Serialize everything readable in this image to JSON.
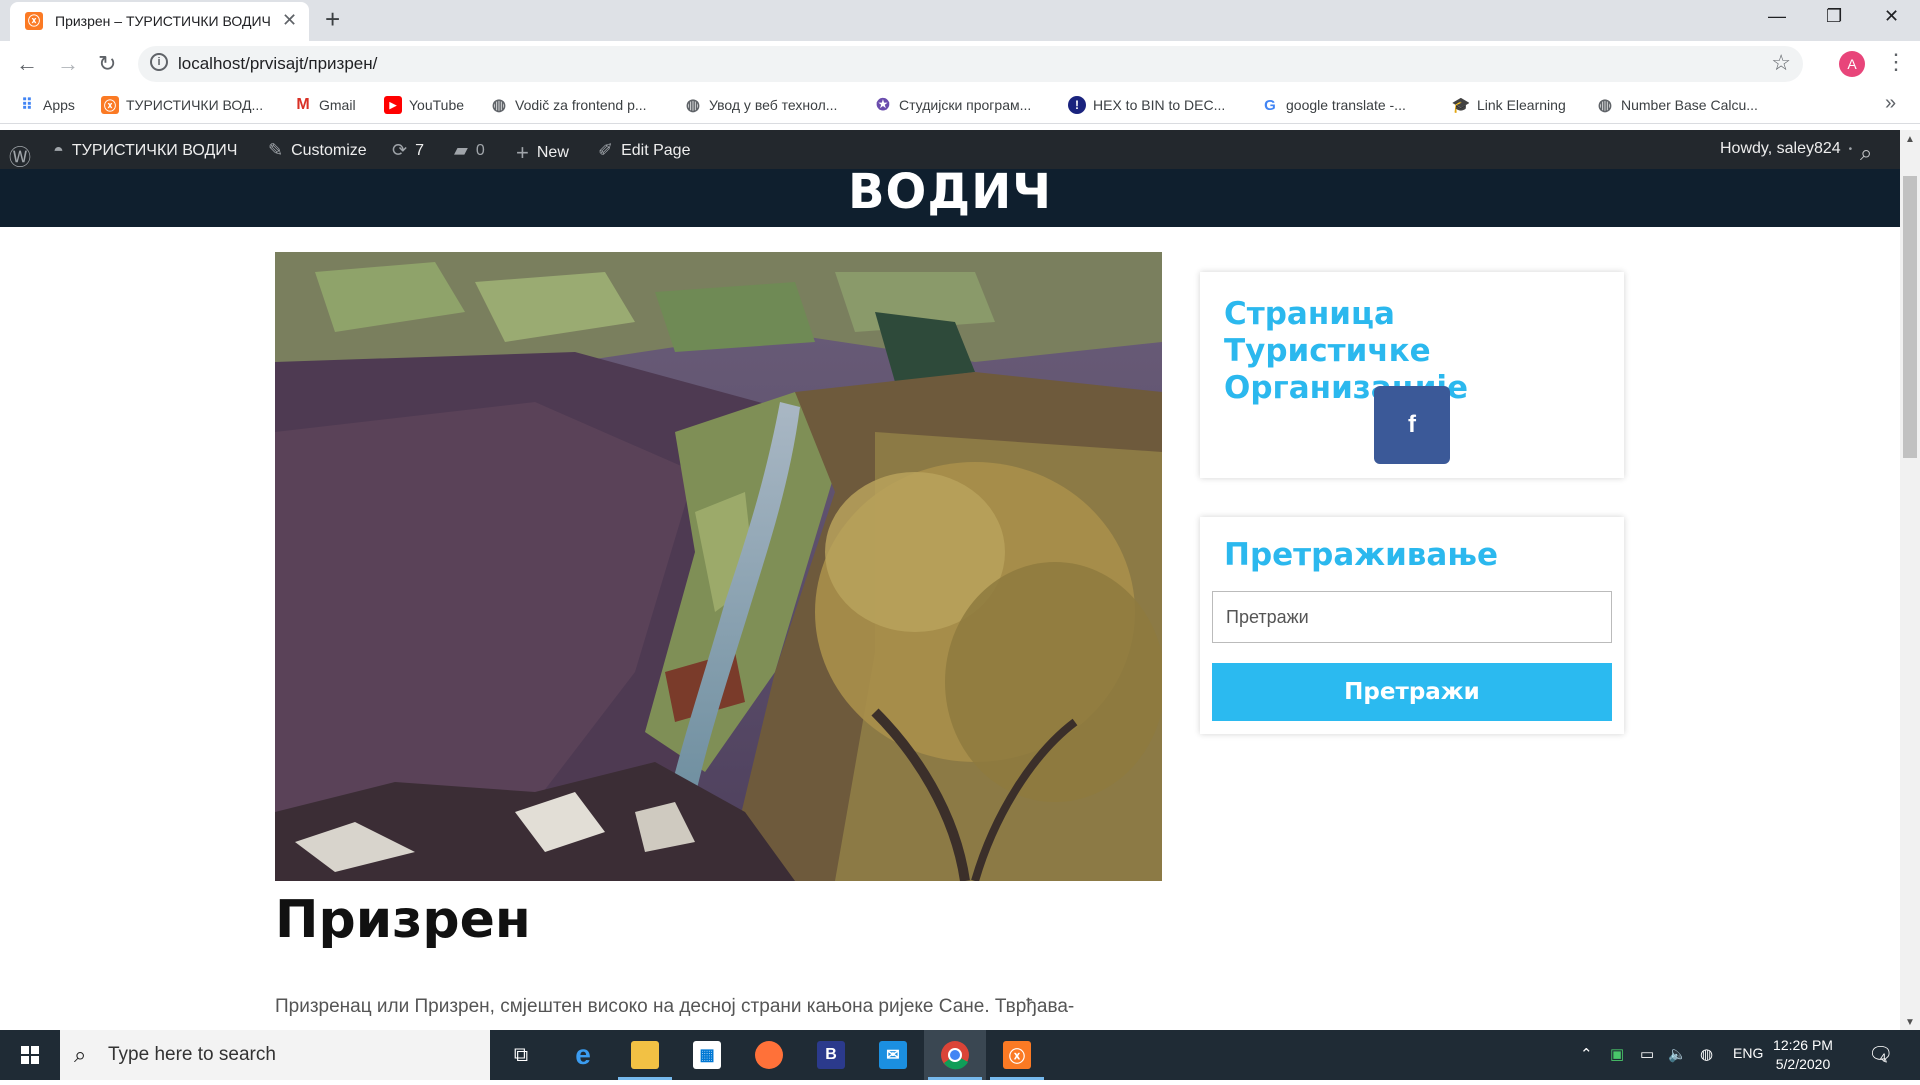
{
  "browser": {
    "tab_title": "Призрен – ТУРИСТИЧКИ ВОДИЧ",
    "tab_favicon": "ⓧ",
    "new_tab": "+",
    "url": "localhost/prvisajt/призрен/",
    "avatar_letter": "A"
  },
  "bookmarks": [
    {
      "label": "Apps",
      "icon": "apps-grid-icon"
    },
    {
      "label": "ТУРИСТИЧКИ ВОД...",
      "icon": "xampp-icon"
    },
    {
      "label": "Gmail",
      "icon": "gmail-icon"
    },
    {
      "label": "YouTube",
      "icon": "youtube-icon"
    },
    {
      "label": "Vodič za frontend p...",
      "icon": "globe-icon"
    },
    {
      "label": "Увод у веб технол...",
      "icon": "globe-icon"
    },
    {
      "label": "Студијски програм...",
      "icon": "university-icon"
    },
    {
      "label": "HEX to BIN to DEC...",
      "icon": "hex-icon"
    },
    {
      "label": "google translate -...",
      "icon": "google-icon"
    },
    {
      "label": "Link Elearning",
      "icon": "hat-icon"
    },
    {
      "label": "Number Base Calcu...",
      "icon": "globe-icon"
    }
  ],
  "adminbar": {
    "site_name": "ТУРИСТИЧКИ ВОДИЧ",
    "customize": "Customize",
    "updates_count": "7",
    "comments_count": "0",
    "new_label": "New",
    "edit_page": "Edit Page",
    "howdy": "Howdy, saley824"
  },
  "site": {
    "header_name": "ВОДИЧ"
  },
  "main": {
    "title": "Призрен",
    "text": "Призренац или Призрен, смјештен високо на десној страни кањона ријеке Сане. Тврђава-"
  },
  "sidebar": {
    "widget1_title": "Страница Туристичке Организације",
    "facebook_label": "f",
    "widget2_title": "Претраживање",
    "search_placeholder": "Претражи",
    "search_button": "Претражи"
  },
  "taskbar": {
    "search_placeholder": "Type here to search",
    "lang": "ENG",
    "time": "12:26 PM",
    "date": "5/2/2020",
    "notifications": "4"
  },
  "colors": {
    "accent": "#2bb8ee",
    "facebook": "#3b5998",
    "adminbar": "#23282d",
    "header": "#0f1f2e"
  }
}
